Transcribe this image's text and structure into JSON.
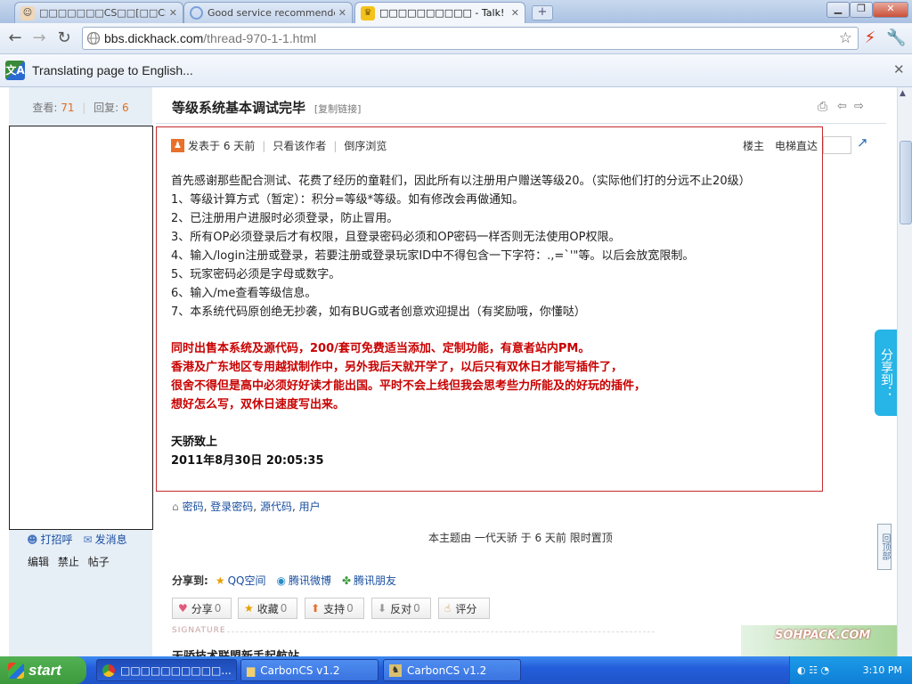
{
  "browser": {
    "tabs": [
      {
        "label": "□□□□□□□CS□□[□□CS□",
        "active": false
      },
      {
        "label": "Good service recommended Ha",
        "active": false
      },
      {
        "label": "□□□□□□□□□□ - Talk!",
        "active": true
      }
    ],
    "url_host": "bbs.dickhack.com",
    "url_path": "/thread-970-1-1.html",
    "translate_text": "Translating page to English..."
  },
  "sidebar": {
    "views_label": "查看:",
    "views": "71",
    "replies_label": "回复:",
    "replies": "6",
    "greet": "打招呼",
    "message": "发消息",
    "admin": [
      "编辑",
      "禁止",
      "帖子"
    ]
  },
  "post": {
    "title": "等级系统基本调试完毕",
    "copy_link": "[复制链接]",
    "meta": {
      "posted": "发表于 6 天前",
      "author_only": "只看该作者",
      "reverse": "倒序浏览",
      "floor": "楼主",
      "elevator": "电梯直达"
    },
    "body": [
      "首先感谢那些配合测试、花费了经历的童鞋们，因此所有以注册用户赠送等级20。（实际他们打的分远不止20级）",
      "1、等级计算方式（暂定）：积分=等级*等级。如有修改会再做通知。",
      "2、已注册用户进服时必须登录，防止冒用。",
      "3、所有OP必须登录后才有权限，且登录密码必须和OP密码一样否则无法使用OP权限。",
      "4、输入/login注册或登录，若要注册或登录玩家ID中不得包含一下字符：.,=`'\"等。以后会放宽限制。",
      "5、玩家密码必须是字母或数字。",
      "6、输入/me查看等级信息。",
      "7、本系统代码原创绝无抄袭，如有BUG或者创意欢迎提出（有奖励哦，你懂哒）"
    ],
    "highlight": [
      "同时出售本系统及源代码，200/套可免费适当添加、定制功能，有意者站内PM。",
      "香港及广东地区专用越狱制作中，另外我后天就开学了，以后只有双休日才能写插件了，",
      "很舍不得但是高中必须好好读才能出国。平时不会上线但我会思考些力所能及的好玩的插件，",
      "想好怎么写，双休日速度写出来。"
    ],
    "signoff": [
      "天骄致上",
      "2011年8月30日 20:05:35"
    ],
    "tags": [
      "密码",
      "登录密码",
      "源代码",
      "用户"
    ],
    "pinned_note": "本主题由 一代天骄 于 6 天前 限时置顶",
    "share_label": "分享到:",
    "share_targets": [
      "QQ空间",
      "腾讯微博",
      "腾讯朋友"
    ],
    "actions": [
      {
        "label": "分享",
        "count": "0"
      },
      {
        "label": "收藏",
        "count": "0"
      },
      {
        "label": "支持",
        "count": "0"
      },
      {
        "label": "反对",
        "count": "0"
      },
      {
        "label": "评分",
        "count": ""
      }
    ],
    "signature_label": "SIGNATURE",
    "signature_text": "天骄技术联盟新手起航站"
  },
  "side_widgets": {
    "share_tab": "分享到：",
    "back_top": "回顶部"
  },
  "watermark": "SOHPACK.COM",
  "taskbar": {
    "start": "start",
    "tasks": [
      "□□□□□□□□□□...",
      "CarbonCS v1.2",
      "CarbonCS v1.2"
    ],
    "clock": "3:10 PM"
  },
  "colors": {
    "accent_link": "#1a4fa0",
    "post_border": "#c82a2a",
    "highlight_text": "#c80000",
    "stat_number": "#e26d1e"
  }
}
